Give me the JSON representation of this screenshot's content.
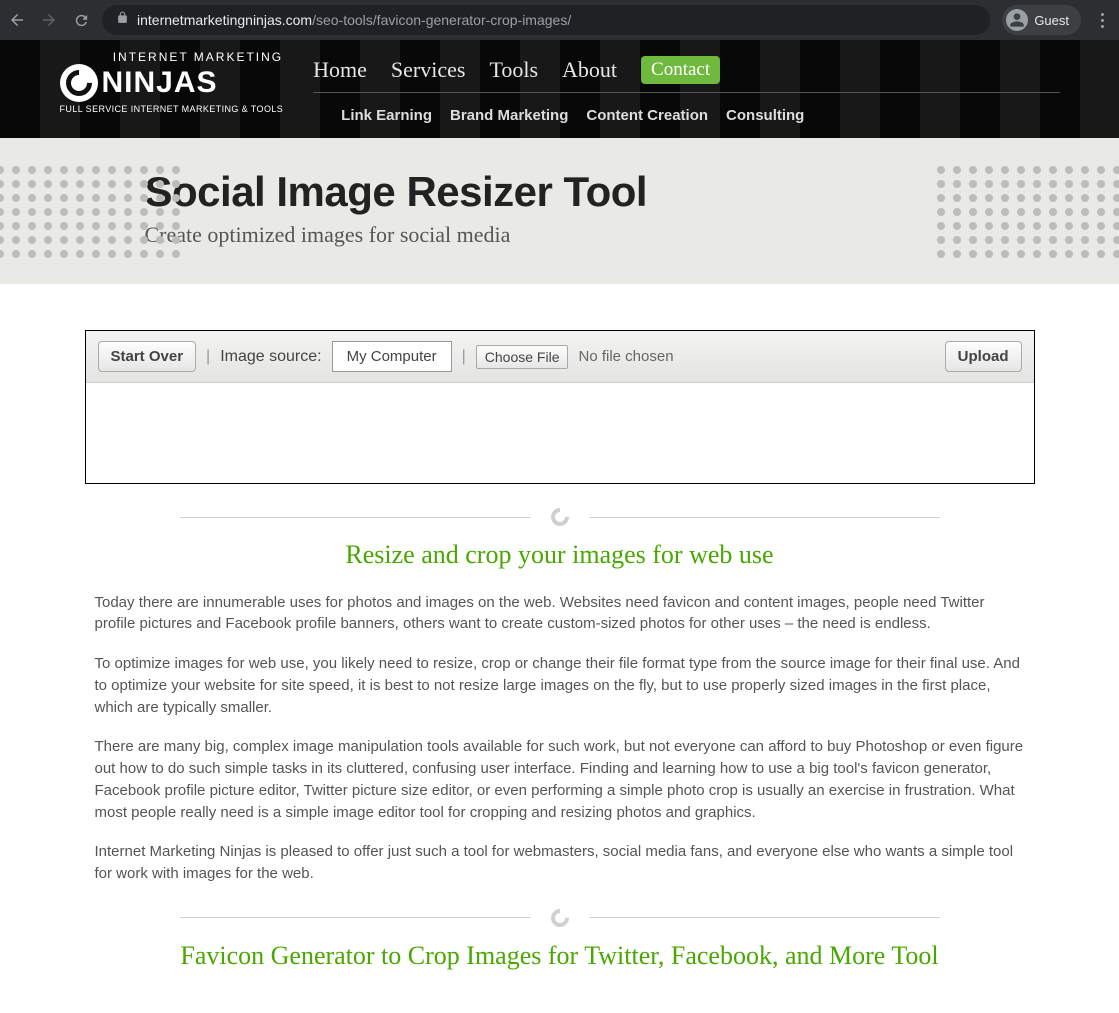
{
  "browser": {
    "domain": "internetmarketingninjas.com",
    "path": "/seo-tools/favicon-generator-crop-images/",
    "guest": "Guest"
  },
  "logo": {
    "top": "INTERNET MARKETING",
    "main": "NINJAS",
    "sub": "FULL SERVICE INTERNET MARKETING & TOOLS"
  },
  "nav": {
    "home": "Home",
    "services": "Services",
    "tools": "Tools",
    "about": "About",
    "contact": "Contact"
  },
  "subnav": {
    "link_earning": "Link Earning",
    "brand_marketing": "Brand Marketing",
    "content_creation": "Content Creation",
    "consulting": "Consulting"
  },
  "hero": {
    "title": "Social Image Resizer Tool",
    "subtitle": "Create optimized images for social media"
  },
  "tool": {
    "start_over": "Start Over",
    "image_source_label": "Image source:",
    "source_value": "My Computer",
    "choose_file": "Choose File",
    "no_file": "No file chosen",
    "upload": "Upload"
  },
  "section1": {
    "heading": "Resize and crop your images for web use",
    "p1": "Today there are innumerable uses for photos and images on the web. Websites need favicon and content images, people need Twitter profile pictures and Facebook profile banners, others want to create custom-sized photos for other uses – the need is endless.",
    "p2": "To optimize images for web use, you likely need to resize, crop or change their file format type from the source image for their final use. And to optimize your website for site speed, it is best to not resize large images on the fly, but to use properly sized images in the first place, which are typically smaller.",
    "p3": "There are many big, complex image manipulation tools available for such work, but not everyone can afford to buy Photoshop or even figure out how to do such simple tasks in its cluttered, confusing user interface. Finding and learning how to use a big tool's favicon generator, Facebook profile picture editor, Twitter picture size editor, or even performing a simple photo crop is usually an exercise in frustration. What most people really need is a simple image editor tool for cropping and resizing photos and graphics.",
    "p4": "Internet Marketing Ninjas is pleased to offer just such a tool for webmasters, social media fans, and everyone else who wants a simple tool for work with images for the web."
  },
  "section2": {
    "heading": "Favicon Generator to Crop Images for Twitter, Facebook, and More Tool"
  }
}
